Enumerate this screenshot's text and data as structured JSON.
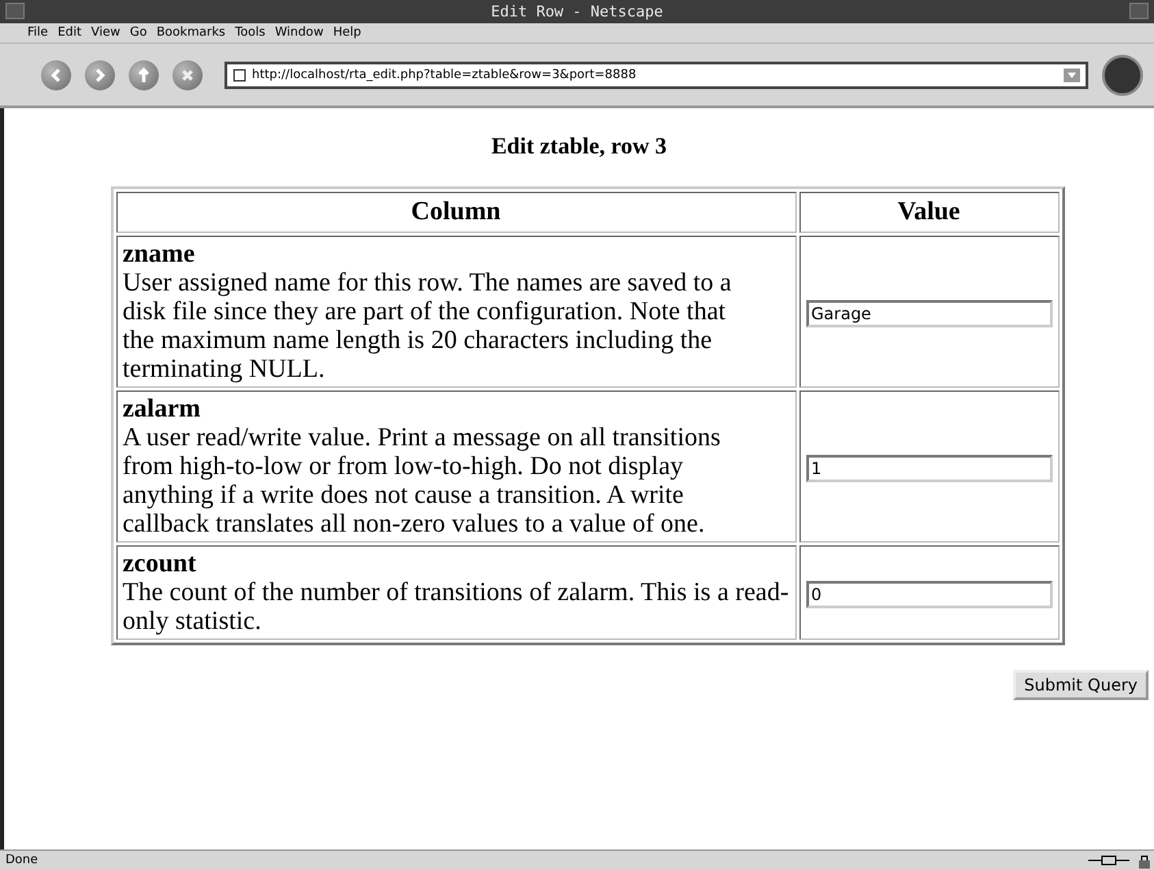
{
  "window": {
    "title": "Edit Row - Netscape"
  },
  "menu": [
    "File",
    "Edit",
    "View",
    "Go",
    "Bookmarks",
    "Tools",
    "Window",
    "Help"
  ],
  "address": {
    "value": "http://localhost/rta_edit.php?table=ztable&row=3&port=8888"
  },
  "page": {
    "heading": "Edit ztable, row 3",
    "table": {
      "columns": [
        "Column",
        "Value"
      ],
      "rows": [
        {
          "name": "zname",
          "description": "User assigned name for this row. The names are saved to a disk file since they are part of the configuration. Note that the maximum name length is 20 characters including the terminating NULL.",
          "value": "Garage"
        },
        {
          "name": "zalarm",
          "description": "A user read/write value. Print a message on all transitions from high-to-low or from low-to-high. Do not display anything if a write does not cause a transition. A write callback translates all non-zero values to a value of one.",
          "value": "1"
        },
        {
          "name": "zcount",
          "description": "The count of the number of transitions of zalarm. This is a read-only statistic.",
          "value": "0"
        }
      ]
    },
    "submit": "Submit Query"
  },
  "status_bar": {
    "text": "Done"
  }
}
